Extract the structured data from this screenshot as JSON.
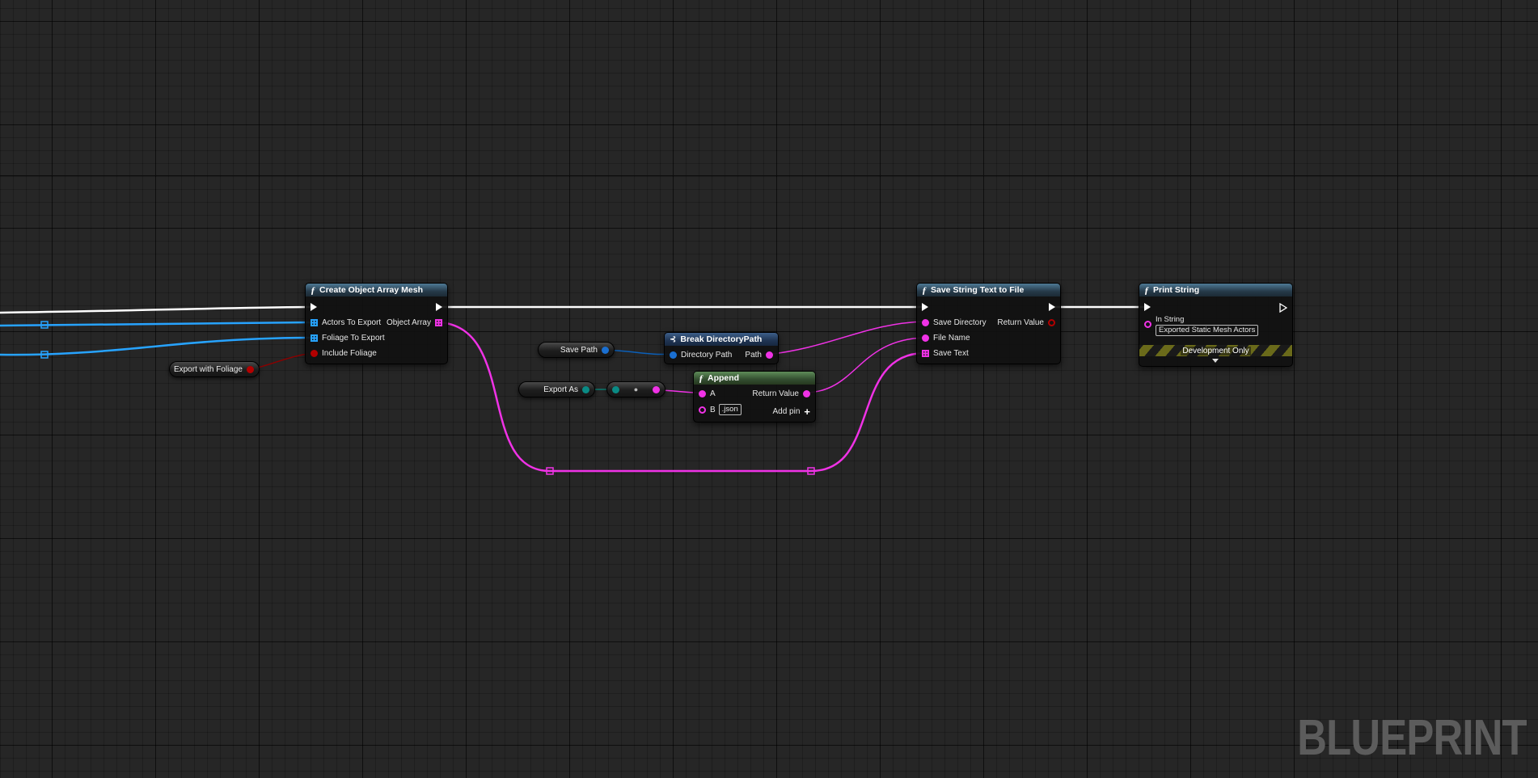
{
  "nodes": {
    "create_object_array_mesh": {
      "title": "Create Object Array Mesh",
      "inputs": [
        "Actors To Export",
        "Foliage To Export",
        "Include Foliage"
      ],
      "output": "Object Array"
    },
    "save_string_text_to_file": {
      "title": "Save String Text to File",
      "inputs": [
        "Save Directory",
        "File Name",
        "Save Text"
      ],
      "output": "Return Value"
    },
    "print_string": {
      "title": "Print String",
      "in_string_label": "In String",
      "in_string_value": "Exported Static Mesh Actors",
      "dev_only": "Development Only"
    },
    "break_directory_path": {
      "title": "Break DirectoryPath",
      "input": "Directory Path",
      "output": "Path"
    },
    "append": {
      "title": "Append",
      "input_a": "A",
      "input_b": "B",
      "input_b_value": ".json",
      "output": "Return Value",
      "add_pin": "Add pin"
    }
  },
  "variables": {
    "export_with_foliage": "Export with Foliage",
    "save_path": "Save Path",
    "export_as": "Export As"
  },
  "watermark": "BLUEPRINT",
  "colors": {
    "exec_wire": "#ffffff",
    "string_wire": "#f032e6",
    "object_wire": "#27a3ff",
    "struct_wire": "#0b5fb8",
    "bool_wire": "#8b0000",
    "enum_wire": "#0a7a70"
  }
}
